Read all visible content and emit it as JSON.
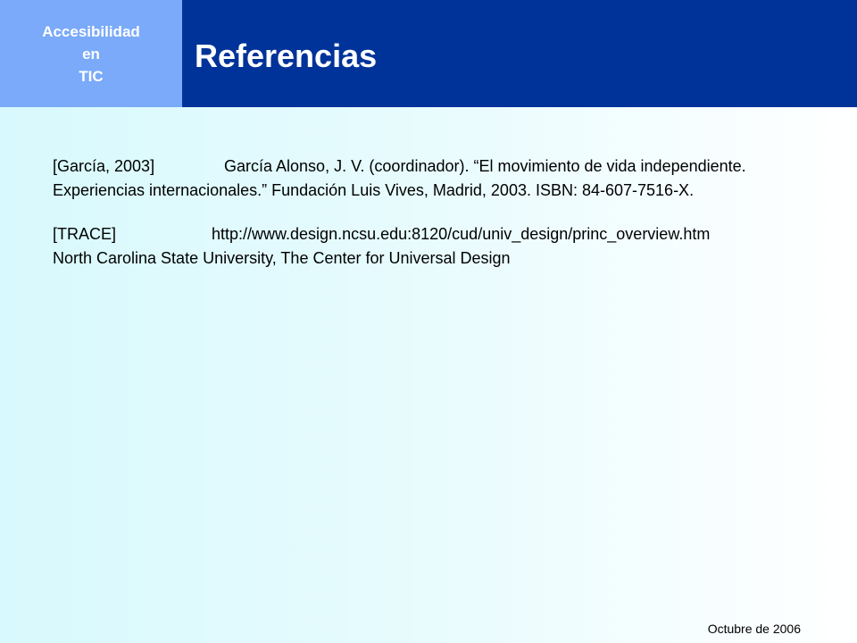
{
  "sidebar": {
    "line1": "Accesibilidad",
    "line2": "en",
    "line3": "TIC"
  },
  "header": {
    "title": "Referencias"
  },
  "references": [
    {
      "key": "[García, 2003]",
      "text": "García Alonso, J. V. (coordinador). “El movimiento de vida independiente. Experiencias internacionales.” Fundación Luis Vives, Madrid, 2003. ISBN: 84-607-7516-X."
    },
    {
      "key": "[TRACE]",
      "url": "http://www.design.ncsu.edu:8120/cud/univ_design/princ_overview.htm",
      "text": "North Carolina State University, The Center for Universal Design"
    }
  ],
  "footer": {
    "date": "Octubre de 2006"
  },
  "colors": {
    "title_bar": "#003399",
    "corner_box": "#7aaaf9",
    "background": "#e6fbfd"
  }
}
